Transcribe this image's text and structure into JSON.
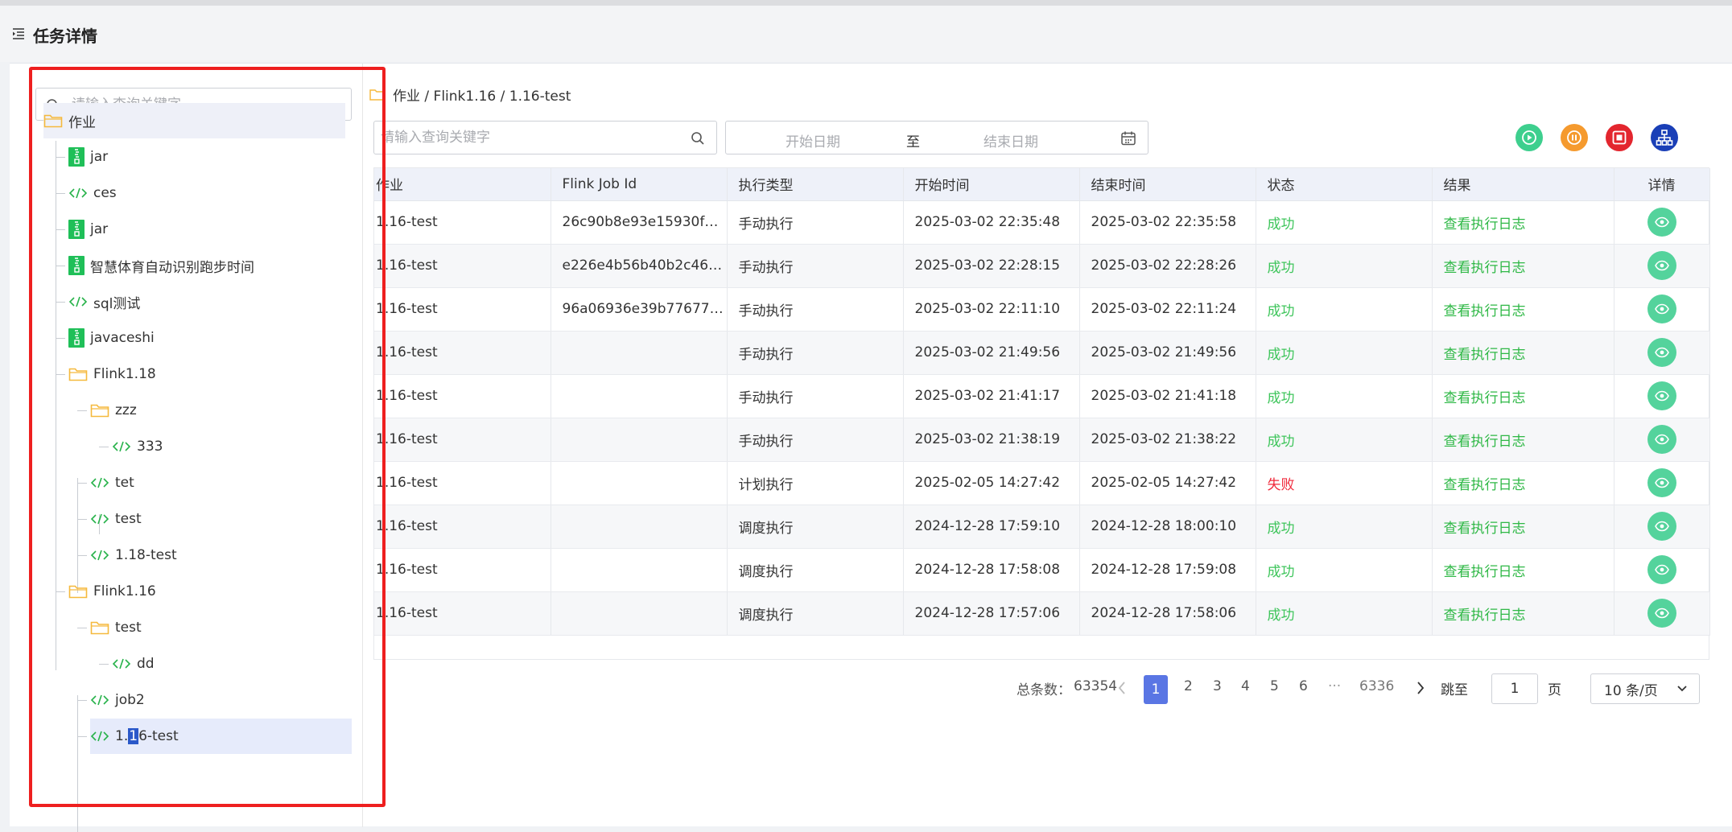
{
  "page": {
    "title": "任务详情"
  },
  "tree": {
    "search_placeholder": "请输入查询关键字",
    "root": "作业",
    "items": [
      {
        "label": "jar",
        "icon": "jar-file-icon"
      },
      {
        "label": "ces",
        "icon": "code-icon"
      },
      {
        "label": "jar",
        "icon": "jar-file-icon"
      },
      {
        "label": "智慧体育自动识别跑步时间",
        "icon": "jar-file-icon"
      },
      {
        "label": "sql测试",
        "icon": "code-icon"
      },
      {
        "label": "javaceshi",
        "icon": "jar-file-icon"
      },
      {
        "label": "Flink1.18",
        "icon": "folder-icon"
      },
      {
        "label": "zzz",
        "icon": "folder-icon"
      },
      {
        "label": "333",
        "icon": "code-icon"
      },
      {
        "label": "tet",
        "icon": "code-icon"
      },
      {
        "label": "test",
        "icon": "code-icon"
      },
      {
        "label": "1.18-test",
        "icon": "code-icon"
      },
      {
        "label": "Flink1.16",
        "icon": "folder-icon"
      },
      {
        "label": "test",
        "icon": "folder-icon"
      },
      {
        "label": "dd",
        "icon": "code-icon"
      },
      {
        "label": "job2",
        "icon": "code-icon"
      }
    ],
    "selected": {
      "pre": "1.",
      "cursor": "1",
      "post": "6-test",
      "icon": "code-icon"
    }
  },
  "main": {
    "breadcrumb": "作业 / Flink1.16 / 1.16-test",
    "search_placeholder": "请输入查询关键字",
    "start_date_placeholder": "开始日期",
    "date_separator": "至",
    "end_date_placeholder": "结束日期",
    "actions": [
      {
        "name": "run-icon",
        "color": "#3ecf8e"
      },
      {
        "name": "pause-icon",
        "color": "#f59a2e"
      },
      {
        "name": "stop-icon",
        "color": "#e3262e"
      },
      {
        "name": "lineage-icon",
        "color": "#1a3fb7"
      }
    ]
  },
  "table": {
    "columns": [
      "作业",
      "Flink Job Id",
      "执行类型",
      "开始时间",
      "结束时间",
      "状态",
      "结果",
      "详情"
    ],
    "rows": [
      {
        "job": "1.16-test",
        "jobid": "26c90b8e93e15930fa…",
        "type": "手动执行",
        "start": "2025-03-02 22:35:48",
        "end": "2025-03-02 22:35:58",
        "status": "成功",
        "result": "查看执行日志"
      },
      {
        "job": "1.16-test",
        "jobid": "e226e4b56b40b2c46…",
        "type": "手动执行",
        "start": "2025-03-02 22:28:15",
        "end": "2025-03-02 22:28:26",
        "status": "成功",
        "result": "查看执行日志"
      },
      {
        "job": "1.16-test",
        "jobid": "96a06936e39b77677…",
        "type": "手动执行",
        "start": "2025-03-02 22:11:10",
        "end": "2025-03-02 22:11:24",
        "status": "成功",
        "result": "查看执行日志"
      },
      {
        "job": "1.16-test",
        "jobid": "",
        "type": "手动执行",
        "start": "2025-03-02 21:49:56",
        "end": "2025-03-02 21:49:56",
        "status": "成功",
        "result": "查看执行日志"
      },
      {
        "job": "1.16-test",
        "jobid": "",
        "type": "手动执行",
        "start": "2025-03-02 21:41:17",
        "end": "2025-03-02 21:41:18",
        "status": "成功",
        "result": "查看执行日志"
      },
      {
        "job": "1.16-test",
        "jobid": "",
        "type": "手动执行",
        "start": "2025-03-02 21:38:19",
        "end": "2025-03-02 21:38:22",
        "status": "成功",
        "result": "查看执行日志"
      },
      {
        "job": "1.16-test",
        "jobid": "",
        "type": "计划执行",
        "start": "2025-02-05 14:27:42",
        "end": "2025-02-05 14:27:42",
        "status": "失败",
        "result": "查看执行日志"
      },
      {
        "job": "1.16-test",
        "jobid": "",
        "type": "调度执行",
        "start": "2024-12-28 17:59:10",
        "end": "2024-12-28 18:00:10",
        "status": "成功",
        "result": "查看执行日志"
      },
      {
        "job": "1.16-test",
        "jobid": "",
        "type": "调度执行",
        "start": "2024-12-28 17:58:08",
        "end": "2024-12-28 17:59:08",
        "status": "成功",
        "result": "查看执行日志"
      },
      {
        "job": "1.16-test",
        "jobid": "",
        "type": "调度执行",
        "start": "2024-12-28 17:57:06",
        "end": "2024-12-28 17:58:06",
        "status": "成功",
        "result": "查看执行日志"
      }
    ]
  },
  "pagination": {
    "total_label": "总条数：",
    "total": "63354",
    "pages": [
      "1",
      "2",
      "3",
      "4",
      "5",
      "6",
      "···",
      "6336"
    ],
    "goto_label": "跳至",
    "goto_value": "1",
    "page_suffix": "页",
    "page_size": "10 条/页"
  },
  "colors": {
    "success": "#3ec55b",
    "fail": "#f0293b",
    "link": "#2fb846",
    "active_page": "#5a76e4",
    "highlight_box": "#ee1f1f"
  }
}
